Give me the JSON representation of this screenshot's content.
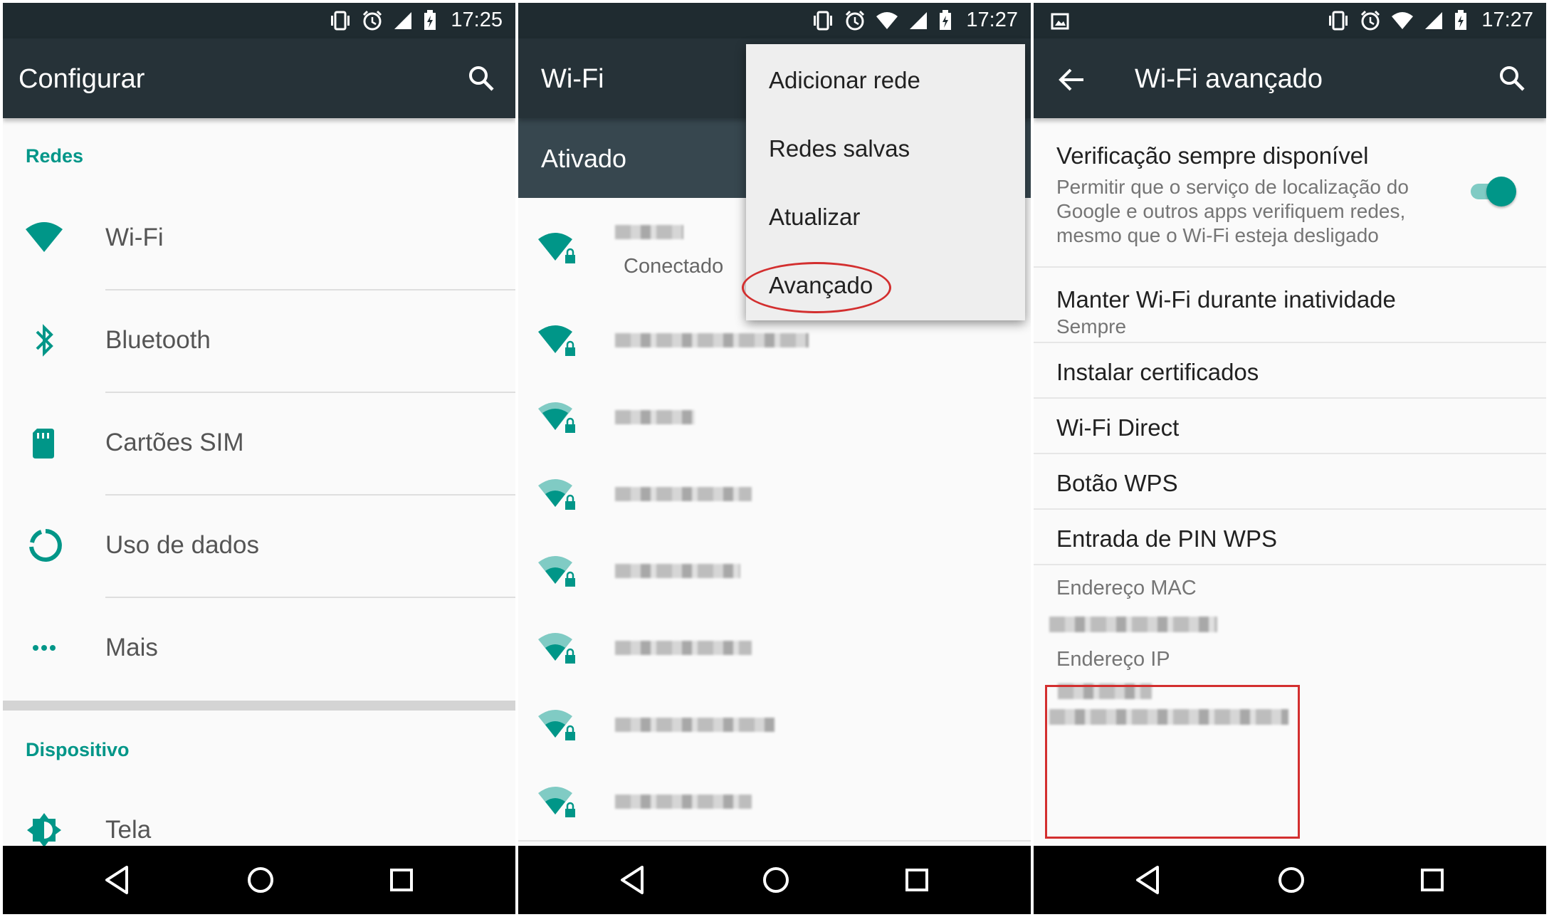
{
  "colors": {
    "accent": "#009688",
    "appbar": "#263238",
    "statusbar": "#1f2b30",
    "highlight": "#d32f2f"
  },
  "panel1": {
    "time": "17:25",
    "title": "Configurar",
    "sections": [
      {
        "header": "Redes",
        "items": [
          {
            "label": "Wi-Fi",
            "icon": "wifi-icon"
          },
          {
            "label": "Bluetooth",
            "icon": "bluetooth-icon"
          },
          {
            "label": "Cartões SIM",
            "icon": "sim-card-icon"
          },
          {
            "label": "Uso de dados",
            "icon": "data-usage-icon"
          },
          {
            "label": "Mais",
            "icon": "more-dots-icon"
          }
        ]
      },
      {
        "header": "Dispositivo",
        "items": [
          {
            "label": "Tela",
            "icon": "brightness-icon"
          }
        ]
      }
    ]
  },
  "panel2": {
    "time": "17:27",
    "title": "Wi-Fi",
    "switch_label": "Ativado",
    "connected_label": "Conectado",
    "menu": [
      "Adicionar rede",
      "Redes salvas",
      "Atualizar",
      "Avançado"
    ],
    "highlighted_menu_item": "Avançado"
  },
  "panel3": {
    "time": "17:27",
    "title": "Wi-Fi avançado",
    "items": [
      {
        "title": "Verificação sempre disponível",
        "summary": "Permitir que o serviço de localização do Google e outros apps verifiquem redes, mesmo que o Wi-Fi esteja desligado",
        "toggle_on": true
      },
      {
        "title": "Manter Wi-Fi durante inatividade",
        "summary": "Sempre"
      },
      {
        "title": "Instalar certificados"
      },
      {
        "title": "Wi-Fi Direct"
      },
      {
        "title": "Botão WPS"
      },
      {
        "title": "Entrada de PIN WPS"
      }
    ],
    "mac_label": "Endereço MAC",
    "ip_label": "Endereço IP"
  }
}
